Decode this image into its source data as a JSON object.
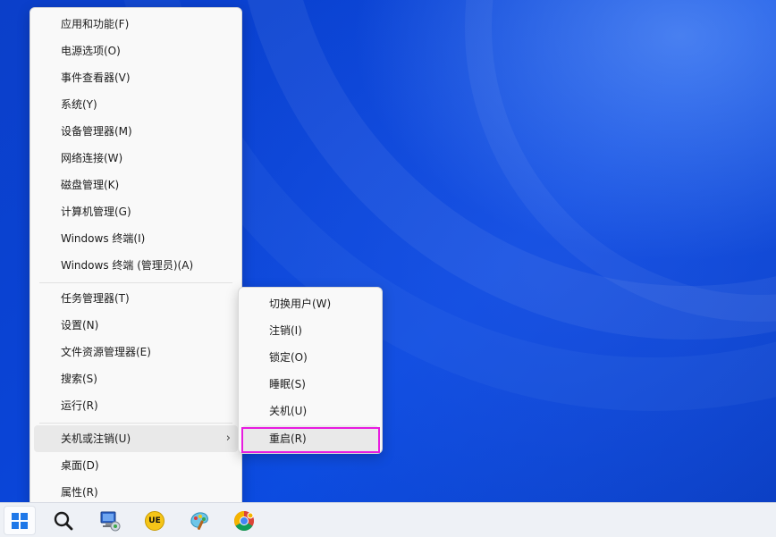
{
  "context_menu": {
    "items_group1": [
      {
        "label": "应用和功能(F)"
      },
      {
        "label": "电源选项(O)"
      },
      {
        "label": "事件查看器(V)"
      },
      {
        "label": "系统(Y)"
      },
      {
        "label": "设备管理器(M)"
      },
      {
        "label": "网络连接(W)"
      },
      {
        "label": "磁盘管理(K)"
      },
      {
        "label": "计算机管理(G)"
      },
      {
        "label": "Windows 终端(I)"
      },
      {
        "label": "Windows 终端 (管理员)(A)"
      }
    ],
    "items_group2": [
      {
        "label": "任务管理器(T)"
      },
      {
        "label": "设置(N)"
      },
      {
        "label": "文件资源管理器(E)"
      },
      {
        "label": "搜索(S)"
      },
      {
        "label": "运行(R)"
      }
    ],
    "shutdown_item": {
      "label": "关机或注销(U)",
      "arrow": "›"
    },
    "items_group3": [
      {
        "label": "桌面(D)"
      },
      {
        "label": "属性(R)"
      }
    ]
  },
  "submenu": {
    "items": [
      {
        "label": "切换用户(W)"
      },
      {
        "label": "注销(I)"
      },
      {
        "label": "锁定(O)"
      },
      {
        "label": "睡眠(S)"
      },
      {
        "label": "关机(U)"
      },
      {
        "label": "重启(R)"
      }
    ],
    "highlighted": "重启(R)",
    "highlight_color": "#e81ce0"
  },
  "taskbar": {
    "icons": [
      "start-icon",
      "search-icon",
      "network-computer-icon",
      "ue-editor-icon",
      "paint-icon",
      "chrome-icon"
    ],
    "ue_label": "UE"
  },
  "colors": {
    "desktop_blue": "#0a44d6",
    "menu_bg": "#f9f9f9",
    "accent": "#1f78e8"
  }
}
